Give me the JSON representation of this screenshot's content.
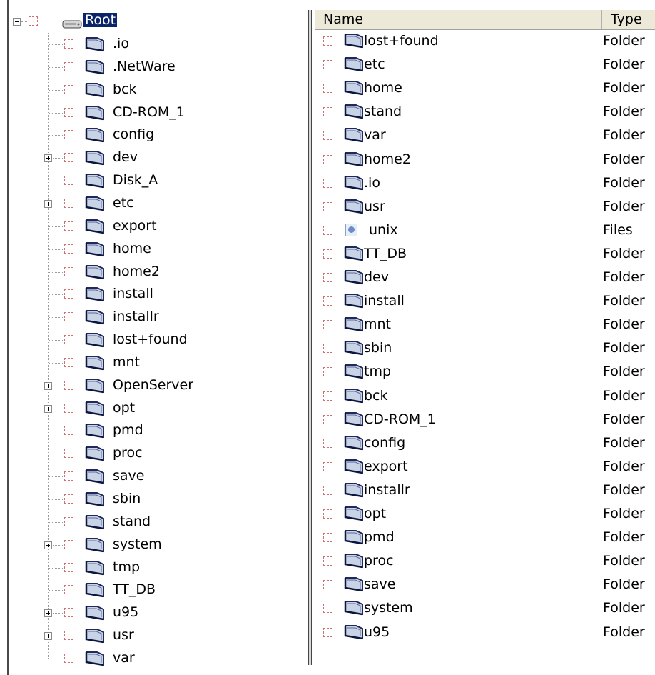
{
  "tree": {
    "root": {
      "label": "Root",
      "icon": "drive-icon"
    },
    "items": [
      {
        "label": ".io",
        "expandable": false,
        "icon": "folder-icon"
      },
      {
        "label": ".NetWare",
        "expandable": false,
        "icon": "folder-icon"
      },
      {
        "label": "bck",
        "expandable": false,
        "icon": "folder-icon"
      },
      {
        "label": "CD-ROM_1",
        "expandable": false,
        "icon": "folder-icon"
      },
      {
        "label": "config",
        "expandable": false,
        "icon": "folder-icon"
      },
      {
        "label": "dev",
        "expandable": true,
        "icon": "folder-icon"
      },
      {
        "label": "Disk_A",
        "expandable": false,
        "icon": "folder-icon"
      },
      {
        "label": "etc",
        "expandable": true,
        "icon": "folder-icon"
      },
      {
        "label": "export",
        "expandable": false,
        "icon": "folder-icon"
      },
      {
        "label": "home",
        "expandable": false,
        "icon": "folder-icon"
      },
      {
        "label": "home2",
        "expandable": false,
        "icon": "folder-icon"
      },
      {
        "label": "install",
        "expandable": false,
        "icon": "folder-icon"
      },
      {
        "label": "installr",
        "expandable": false,
        "icon": "folder-icon"
      },
      {
        "label": "lost+found",
        "expandable": false,
        "icon": "folder-icon"
      },
      {
        "label": "mnt",
        "expandable": false,
        "icon": "folder-icon"
      },
      {
        "label": "OpenServer",
        "expandable": true,
        "icon": "folder-icon"
      },
      {
        "label": "opt",
        "expandable": true,
        "icon": "folder-icon"
      },
      {
        "label": "pmd",
        "expandable": false,
        "icon": "folder-icon"
      },
      {
        "label": "proc",
        "expandable": false,
        "icon": "folder-icon"
      },
      {
        "label": "save",
        "expandable": false,
        "icon": "folder-icon"
      },
      {
        "label": "sbin",
        "expandable": false,
        "icon": "folder-icon"
      },
      {
        "label": "stand",
        "expandable": false,
        "icon": "folder-icon"
      },
      {
        "label": "system",
        "expandable": true,
        "icon": "folder-icon"
      },
      {
        "label": "tmp",
        "expandable": false,
        "icon": "folder-icon"
      },
      {
        "label": "TT_DB",
        "expandable": false,
        "icon": "folder-icon"
      },
      {
        "label": "u95",
        "expandable": true,
        "icon": "folder-icon"
      },
      {
        "label": "usr",
        "expandable": true,
        "icon": "folder-icon"
      },
      {
        "label": "var",
        "expandable": false,
        "icon": "folder-icon"
      }
    ]
  },
  "list": {
    "columns": [
      "Name",
      "Type"
    ],
    "rows": [
      {
        "name": "lost+found",
        "type": "Folder",
        "icon": "folder-icon"
      },
      {
        "name": "etc",
        "type": "Folder",
        "icon": "folder-icon"
      },
      {
        "name": "home",
        "type": "Folder",
        "icon": "folder-icon"
      },
      {
        "name": "stand",
        "type": "Folder",
        "icon": "folder-icon"
      },
      {
        "name": "var",
        "type": "Folder",
        "icon": "folder-icon"
      },
      {
        "name": "home2",
        "type": "Folder",
        "icon": "folder-icon"
      },
      {
        "name": ".io",
        "type": "Folder",
        "icon": "folder-icon"
      },
      {
        "name": "usr",
        "type": "Folder",
        "icon": "folder-icon"
      },
      {
        "name": "unix",
        "type": "Files",
        "icon": "file-icon"
      },
      {
        "name": "TT_DB",
        "type": "Folder",
        "icon": "folder-icon"
      },
      {
        "name": "dev",
        "type": "Folder",
        "icon": "folder-icon"
      },
      {
        "name": "install",
        "type": "Folder",
        "icon": "folder-icon"
      },
      {
        "name": "mnt",
        "type": "Folder",
        "icon": "folder-icon"
      },
      {
        "name": "sbin",
        "type": "Folder",
        "icon": "folder-icon"
      },
      {
        "name": "tmp",
        "type": "Folder",
        "icon": "folder-icon"
      },
      {
        "name": "bck",
        "type": "Folder",
        "icon": "folder-icon"
      },
      {
        "name": "CD-ROM_1",
        "type": "Folder",
        "icon": "folder-icon"
      },
      {
        "name": "config",
        "type": "Folder",
        "icon": "folder-icon"
      },
      {
        "name": "export",
        "type": "Folder",
        "icon": "folder-icon"
      },
      {
        "name": "installr",
        "type": "Folder",
        "icon": "folder-icon"
      },
      {
        "name": "opt",
        "type": "Folder",
        "icon": "folder-icon"
      },
      {
        "name": "pmd",
        "type": "Folder",
        "icon": "folder-icon"
      },
      {
        "name": "proc",
        "type": "Folder",
        "icon": "folder-icon"
      },
      {
        "name": "save",
        "type": "Folder",
        "icon": "folder-icon"
      },
      {
        "name": "system",
        "type": "Folder",
        "icon": "folder-icon"
      },
      {
        "name": "u95",
        "type": "Folder",
        "icon": "folder-icon"
      }
    ]
  },
  "colors": {
    "selection": "#0a246a",
    "checkbox_border": "#d07070",
    "folder_body": "#c9d3e6",
    "folder_outline": "#1f2a5a",
    "header_bg": "#ece9d8"
  }
}
